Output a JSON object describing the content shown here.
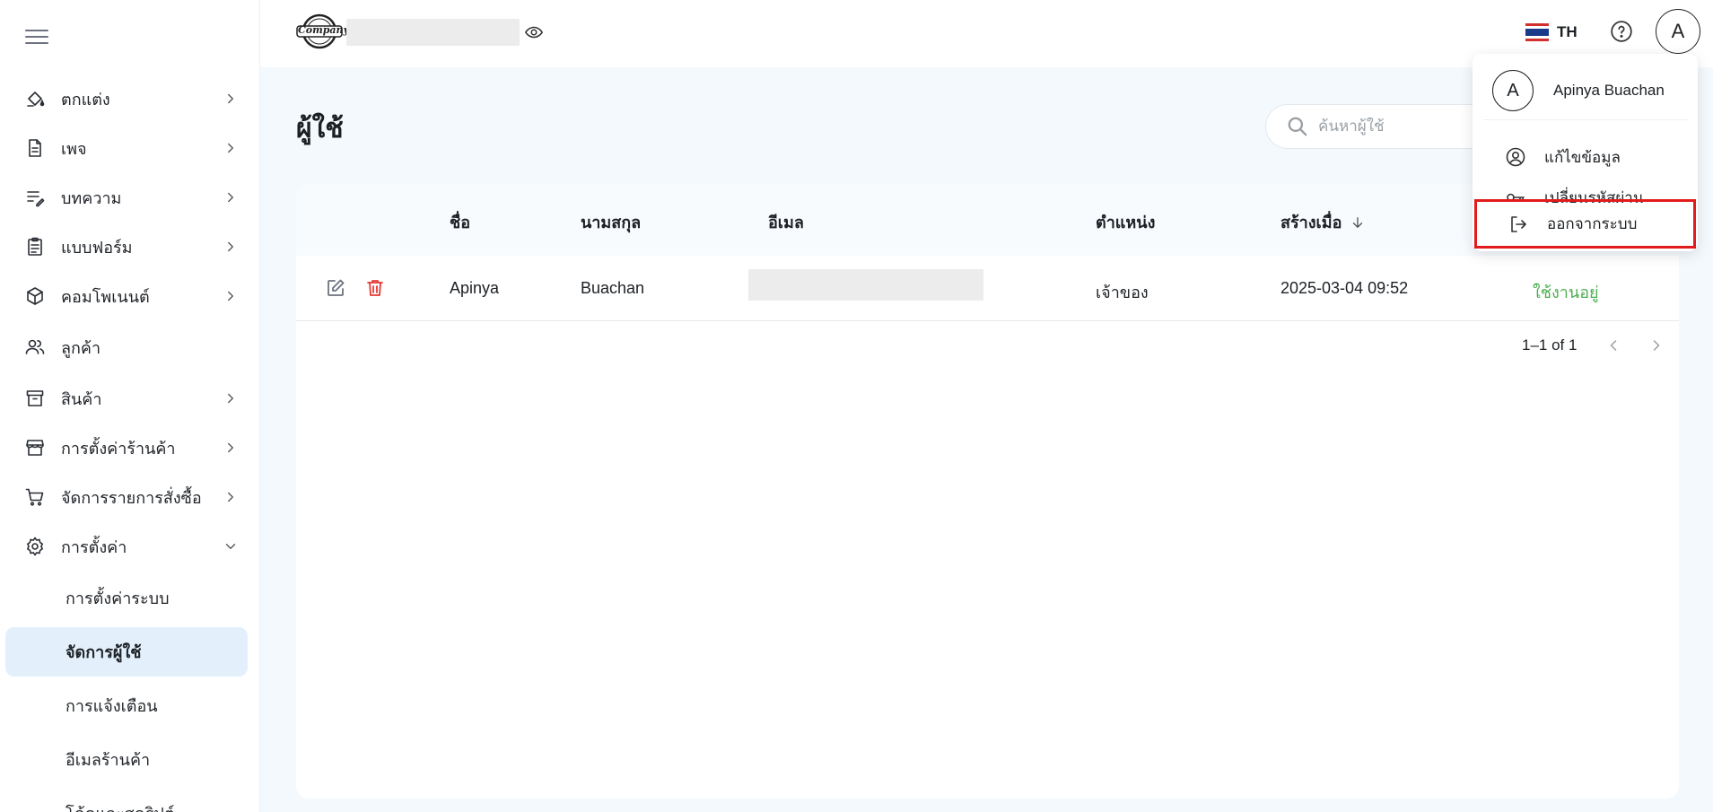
{
  "sidebar": {
    "items": [
      {
        "label": "ตกแต่ง",
        "icon": "paint-bucket-icon"
      },
      {
        "label": "เพจ",
        "icon": "document-icon"
      },
      {
        "label": "บทความ",
        "icon": "article-edit-icon"
      },
      {
        "label": "แบบฟอร์ม",
        "icon": "clipboard-icon"
      },
      {
        "label": "คอมโพเนนต์",
        "icon": "cube-icon"
      },
      {
        "label": "ลูกค้า",
        "icon": "customers-icon"
      },
      {
        "label": "สินค้า",
        "icon": "archive-box-icon"
      },
      {
        "label": "การตั้งค่าร้านค้า",
        "icon": "storefront-icon"
      },
      {
        "label": "จัดการรายการสั่งซื้อ",
        "icon": "cart-icon"
      },
      {
        "label": "การตั้งค่า",
        "icon": "gear-icon"
      }
    ],
    "sub_items": [
      {
        "label": "การตั้งค่าระบบ"
      },
      {
        "label": "จัดการผู้ใช้"
      },
      {
        "label": "การแจ้งเตือน"
      },
      {
        "label": "อีเมลร้านค้า"
      },
      {
        "label": "โค้ดและสคริปต์"
      }
    ]
  },
  "header": {
    "logo_text": "Company",
    "language": "TH",
    "avatar_letter": "A"
  },
  "main": {
    "title": "ผู้ใช้",
    "search_placeholder": "ค้นหาผู้ใช้",
    "columns": [
      "ชื่อ",
      "นามสกุล",
      "อีเมล",
      "ตำแหน่ง",
      "สร้างเมื่อ"
    ],
    "rows": [
      {
        "first_name": "Apinya",
        "last_name": "Buachan",
        "role": "เจ้าของ",
        "created": "2025-03-04 09:52",
        "status": "ใช้งานอยู่"
      }
    ],
    "pagination": "1–1 of 1"
  },
  "dropdown": {
    "avatar_letter": "A",
    "user_name": "Apinya Buachan",
    "edit_profile": "แก้ไขข้อมูล",
    "change_password": "เปลี่ยนรหัสผ่าน",
    "logout": "ออกจากระบบ"
  },
  "colors": {
    "active_status": "#4caf50",
    "delete_icon": "#e53935",
    "highlight_border": "#e21b1b",
    "active_nav_bg": "#e3f0fb"
  }
}
